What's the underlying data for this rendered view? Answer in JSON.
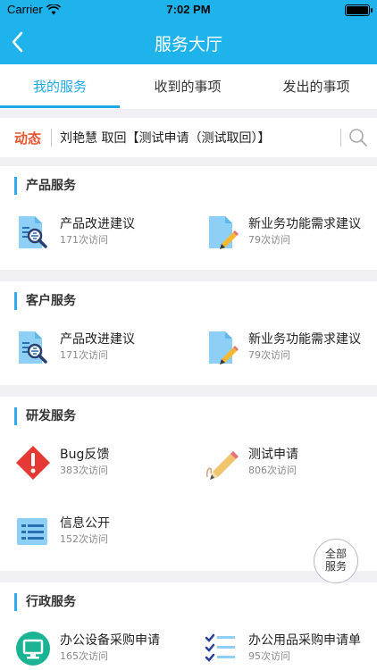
{
  "status_bar": {
    "carrier": "Carrier",
    "time": "7:02 PM"
  },
  "navbar": {
    "title": "服务大厅"
  },
  "tabs": [
    {
      "label": "我的服务"
    },
    {
      "label": "收到的事项"
    },
    {
      "label": "发出的事项"
    }
  ],
  "news": {
    "label": "动态",
    "text": "刘艳慧 取回【测试申请（测试取回）】"
  },
  "sections": {
    "product": {
      "title": "产品服务",
      "items": [
        {
          "name": "产品改进建议",
          "visits": "171次访问",
          "icon": "report-search-icon"
        },
        {
          "name": "新业务功能需求建议",
          "visits": "79次访问",
          "icon": "document-edit-icon"
        }
      ]
    },
    "customer": {
      "title": "客户服务",
      "items": [
        {
          "name": "产品改进建议",
          "visits": "171次访问",
          "icon": "report-search-icon"
        },
        {
          "name": "新业务功能需求建议",
          "visits": "79次访问",
          "icon": "document-edit-icon"
        }
      ]
    },
    "rd": {
      "title": "研发服务",
      "items": [
        {
          "name": "Bug反馈",
          "visits": "383次访问",
          "icon": "alert-diamond-icon"
        },
        {
          "name": "测试申请",
          "visits": "806次访问",
          "icon": "pencil-icon"
        },
        {
          "name": "信息公开",
          "visits": "152次访问",
          "icon": "info-list-icon"
        }
      ]
    },
    "admin": {
      "title": "行政服务",
      "items": [
        {
          "name": "办公设备采购申请",
          "visits": "165次访问",
          "icon": "monitor-icon"
        },
        {
          "name": "办公用品采购申请单",
          "visits": "95次访问",
          "icon": "checklist-icon"
        }
      ]
    }
  },
  "all_button": {
    "line1": "全部",
    "line2": "服务"
  },
  "colors": {
    "accent": "#1fb3ec",
    "tab_active": "#1fa8e6",
    "news_label": "#e8562f",
    "bug_red": "#e53935",
    "monitor_teal": "#1ab394"
  }
}
